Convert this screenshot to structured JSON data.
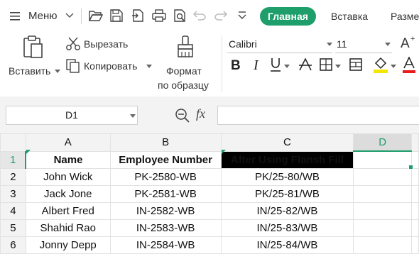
{
  "menu": {
    "label": "Меню",
    "tabs": [
      {
        "label": "Главная",
        "active": true
      },
      {
        "label": "Вставка",
        "active": false
      },
      {
        "label": "Разме",
        "active": false
      }
    ]
  },
  "ribbon": {
    "paste_label": "Вставить",
    "cut_label": "Вырезать",
    "copy_label": "Копировать",
    "format_painter_line1": "Формат",
    "format_painter_line2": "по образцу",
    "font_name": "Calibri",
    "font_size": "11"
  },
  "formula_bar": {
    "name_box": "D1",
    "fx_label": "fx",
    "formula": ""
  },
  "grid": {
    "columns": [
      "A",
      "B",
      "C",
      "D"
    ],
    "selected_column": "D",
    "rows": [
      {
        "num": "1",
        "cells": [
          "Name",
          "Employee Number",
          "After Using Flansh Fill",
          ""
        ]
      },
      {
        "num": "2",
        "cells": [
          "John Wick",
          "PK-2580-WB",
          "PK/25-80/WB",
          ""
        ]
      },
      {
        "num": "3",
        "cells": [
          "Jack Jone",
          "PK-2581-WB",
          "PK/25-81/WB",
          ""
        ]
      },
      {
        "num": "4",
        "cells": [
          "Albert Fred",
          "IN-2582-WB",
          "IN/25-82/WB",
          ""
        ]
      },
      {
        "num": "5",
        "cells": [
          "Shahid Rao",
          "IN-2583-WB",
          "IN/25-83/WB",
          ""
        ]
      },
      {
        "num": "6",
        "cells": [
          "Jonny Depp",
          "IN-2584-WB",
          "IN/25-84/WB",
          ""
        ]
      }
    ]
  },
  "colors": {
    "accent": "#1e9e6a",
    "header_fill": "#000000",
    "header_text": "#ff1a1a"
  }
}
